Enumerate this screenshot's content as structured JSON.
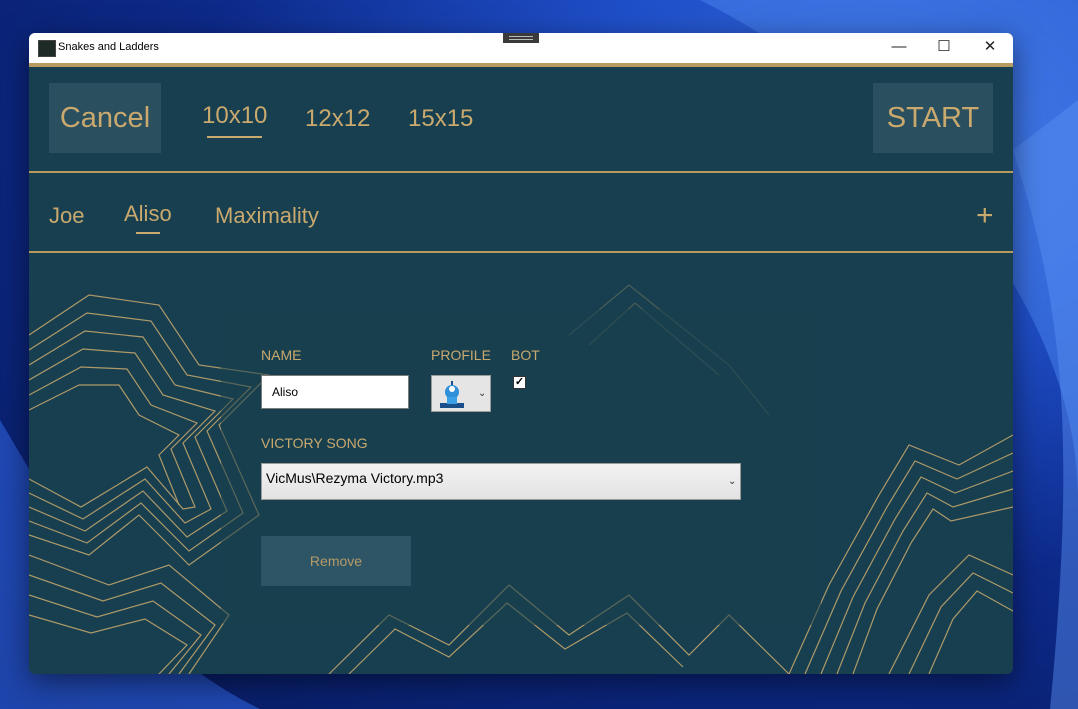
{
  "window": {
    "title": "Snakes and Ladders"
  },
  "controls": {
    "minimize": "—",
    "maximize": "☐",
    "close": "✕"
  },
  "topbar": {
    "cancel_label": "Cancel",
    "start_label": "START",
    "board_sizes": [
      "10x10",
      "12x12",
      "15x15"
    ],
    "selected_size": "10x10"
  },
  "players": {
    "tabs": [
      "Joe",
      "Aliso",
      "Maximality"
    ],
    "selected": "Aliso",
    "add_label": "+"
  },
  "form": {
    "name_label": "NAME",
    "name_value": "Aliso",
    "profile_label": "PROFILE",
    "bot_label": "BOT",
    "bot_checked": true,
    "bot_mark": "✓",
    "victory_song_label": "VICTORY SONG",
    "victory_song_value": "VicMus\\Rezyma Victory.mp3",
    "remove_label": "Remove"
  },
  "colors": {
    "background": "#173f4f",
    "accent_gold": "#c9a96e",
    "button_bg": "#2a4f5e"
  }
}
